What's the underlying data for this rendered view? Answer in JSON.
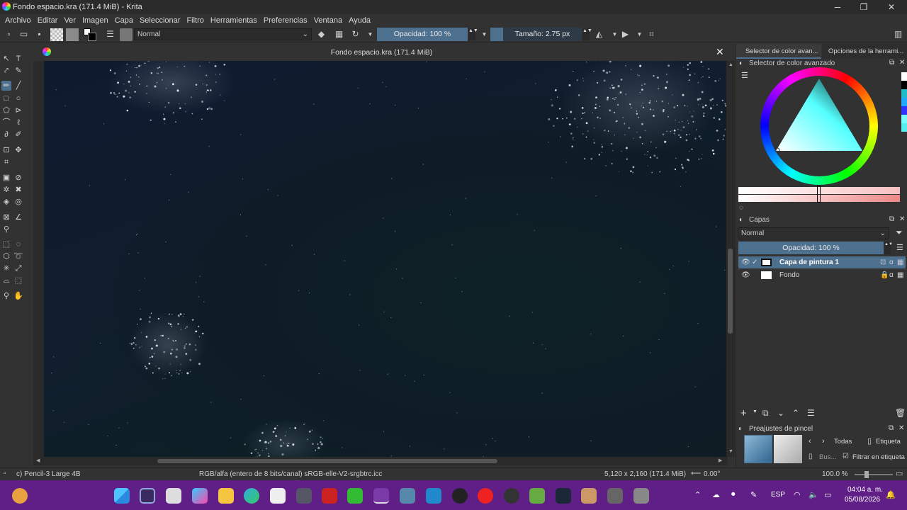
{
  "window": {
    "title": "Fondo espacio.kra (171.4 MiB)  - Krita",
    "minimize": "─",
    "maximize": "❐",
    "close": "✕"
  },
  "menu": [
    "Archivo",
    "Editar",
    "Ver",
    "Imagen",
    "Capa",
    "Seleccionar",
    "Filtro",
    "Herramientas",
    "Preferencias",
    "Ventana",
    "Ayuda"
  ],
  "toolbar": {
    "blend_mode": "Normal",
    "opacity": "Opacidad: 100 %",
    "size": "Tamaño: 2.75 px"
  },
  "document_tab": {
    "title": "Fondo espacio.kra (171.4 MiB)",
    "close": "✕"
  },
  "dock_tabs": [
    "Selector de color avan...",
    "Opciones de la herrami..."
  ],
  "color_selector": {
    "title": "Selector de color avanzado"
  },
  "layers": {
    "title": "Capas",
    "blend": "Normal",
    "opacity": "Opacidad:  100 %",
    "items": [
      {
        "name": "Capa de pintura 1",
        "active": true
      },
      {
        "name": "Fondo",
        "active": false
      }
    ]
  },
  "brush_presets": {
    "title": "Preajustes de pincel",
    "filter": "Todas",
    "tag": "Etiqueta",
    "search": "Bus...",
    "filter_tag": "Filtrar en etiqueta"
  },
  "status": {
    "brush": "c) Pencil-3 Large 4B",
    "color_space": "RGB/alfa (entero de 8 bits/canal)  sRGB-elle-V2-srgbtrc.icc",
    "dims": "5,120 x 2,160 (171.4 MiB)",
    "rotation": "0.00°",
    "zoom": "100.0 %"
  },
  "taskbar": {
    "lang": "ESP",
    "time": "04:04 a. m.",
    "date": "05/08/2026"
  },
  "colors": {
    "accent": "#4e708f",
    "taskbar": "#5f1f87"
  }
}
